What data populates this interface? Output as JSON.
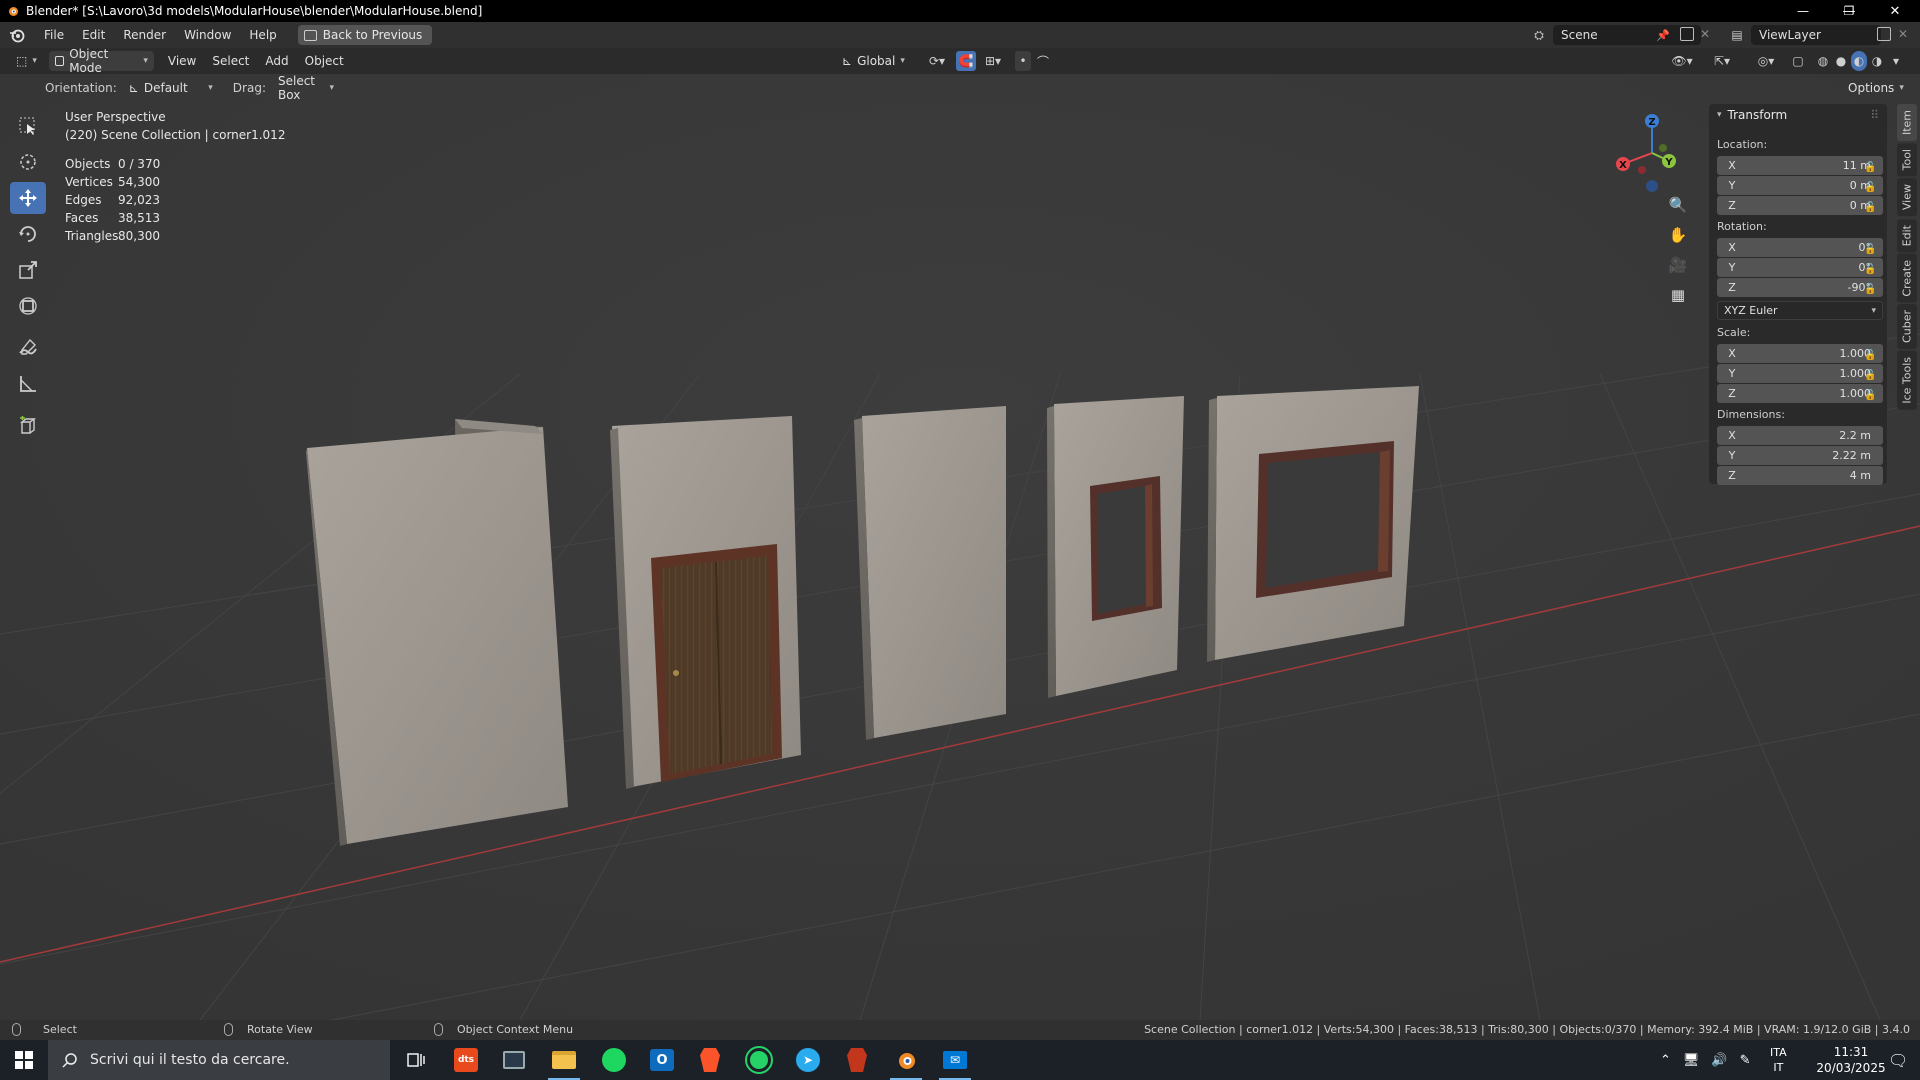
{
  "window": {
    "title": "Blender* [S:\\Lavoro\\3d models\\ModularHouse\\blender\\ModularHouse.blend]",
    "controls": [
      "—",
      "❐",
      "✕"
    ]
  },
  "topbar": {
    "menus": [
      "File",
      "Edit",
      "Render",
      "Window",
      "Help"
    ],
    "back_button": "Back to Previous",
    "scene_name": "Scene",
    "view_layer": "ViewLayer"
  },
  "viewport_header": {
    "mode": "Object Mode",
    "menus": [
      "View",
      "Select",
      "Add",
      "Object"
    ],
    "transform_orientation": "Global",
    "options": "Options"
  },
  "tool_settings": {
    "orientation_label": "Orientation:",
    "orientation_value": "Default",
    "drag_label": "Drag:",
    "drag_value": "Select Box"
  },
  "viewport": {
    "perspective": "User Perspective",
    "collection_info": "(220) Scene Collection | corner1.012",
    "stats": [
      {
        "label": "Objects",
        "value": "0 / 370"
      },
      {
        "label": "Vertices",
        "value": "54,300"
      },
      {
        "label": "Edges",
        "value": "92,023"
      },
      {
        "label": "Faces",
        "value": "38,513"
      },
      {
        "label": "Triangles",
        "value": "80,300"
      }
    ],
    "gizmo_axes": {
      "x": "X",
      "y": "Y",
      "z": "Z"
    }
  },
  "npanel": {
    "header": "Transform",
    "location_label": "Location:",
    "location": [
      {
        "axis": "X",
        "value": "11 m"
      },
      {
        "axis": "Y",
        "value": "0 m"
      },
      {
        "axis": "Z",
        "value": "0 m"
      }
    ],
    "rotation_label": "Rotation:",
    "rotation": [
      {
        "axis": "X",
        "value": "0°"
      },
      {
        "axis": "Y",
        "value": "0°"
      },
      {
        "axis": "Z",
        "value": "-90°"
      }
    ],
    "rotation_mode": "XYZ Euler",
    "scale_label": "Scale:",
    "scale": [
      {
        "axis": "X",
        "value": "1.000"
      },
      {
        "axis": "Y",
        "value": "1.000"
      },
      {
        "axis": "Z",
        "value": "1.000"
      }
    ],
    "dimensions_label": "Dimensions:",
    "dimensions": [
      {
        "axis": "X",
        "value": "2.2 m"
      },
      {
        "axis": "Y",
        "value": "2.22 m"
      },
      {
        "axis": "Z",
        "value": "4 m"
      }
    ],
    "tabs": [
      "Item",
      "Tool",
      "View",
      "Edit",
      "Create",
      "Cuber",
      "Ice Tools"
    ]
  },
  "statusbar": {
    "select": "Select",
    "rotate_view": "Rotate View",
    "context_menu": "Object Context Menu",
    "info": "Scene Collection | corner1.012 | Verts:54,300 | Faces:38,513 | Tris:80,300 | Objects:0/370 | Memory: 392.4 MiB | VRAM: 1.9/12.0 GiB | 3.4.0"
  },
  "taskbar": {
    "search_placeholder": "Scrivi qui il testo da cercare.",
    "language_top": "ITA",
    "language_bottom": "IT",
    "time": "11:31",
    "date": "20/03/2025"
  },
  "colors": {
    "accent": "#4772b3",
    "x_axis": "#e8454d",
    "y_axis": "#8bc53f",
    "z_axis": "#3a7fd6"
  }
}
